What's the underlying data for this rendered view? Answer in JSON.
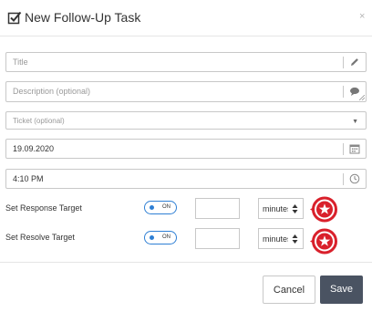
{
  "dialog": {
    "title": "New Follow-Up Task",
    "close_icon": "×"
  },
  "fields": {
    "title_placeholder": "Title",
    "description_placeholder": "Description (optional)",
    "ticket_placeholder": "Ticket (optional)",
    "date_value": "19.09.2020",
    "time_value": "4:10 PM"
  },
  "response_target": {
    "label": "Set Response Target",
    "toggle_label": "ON",
    "value": "",
    "unit": "minutes"
  },
  "resolve_target": {
    "label": "Set Resolve Target",
    "toggle_label": "ON",
    "value": "",
    "unit": "minutes"
  },
  "buttons": {
    "cancel": "Cancel",
    "save": "Save"
  },
  "colors": {
    "accent": "#2e7fd4",
    "badge": "#d9202b",
    "save_button": "#4a5362"
  }
}
